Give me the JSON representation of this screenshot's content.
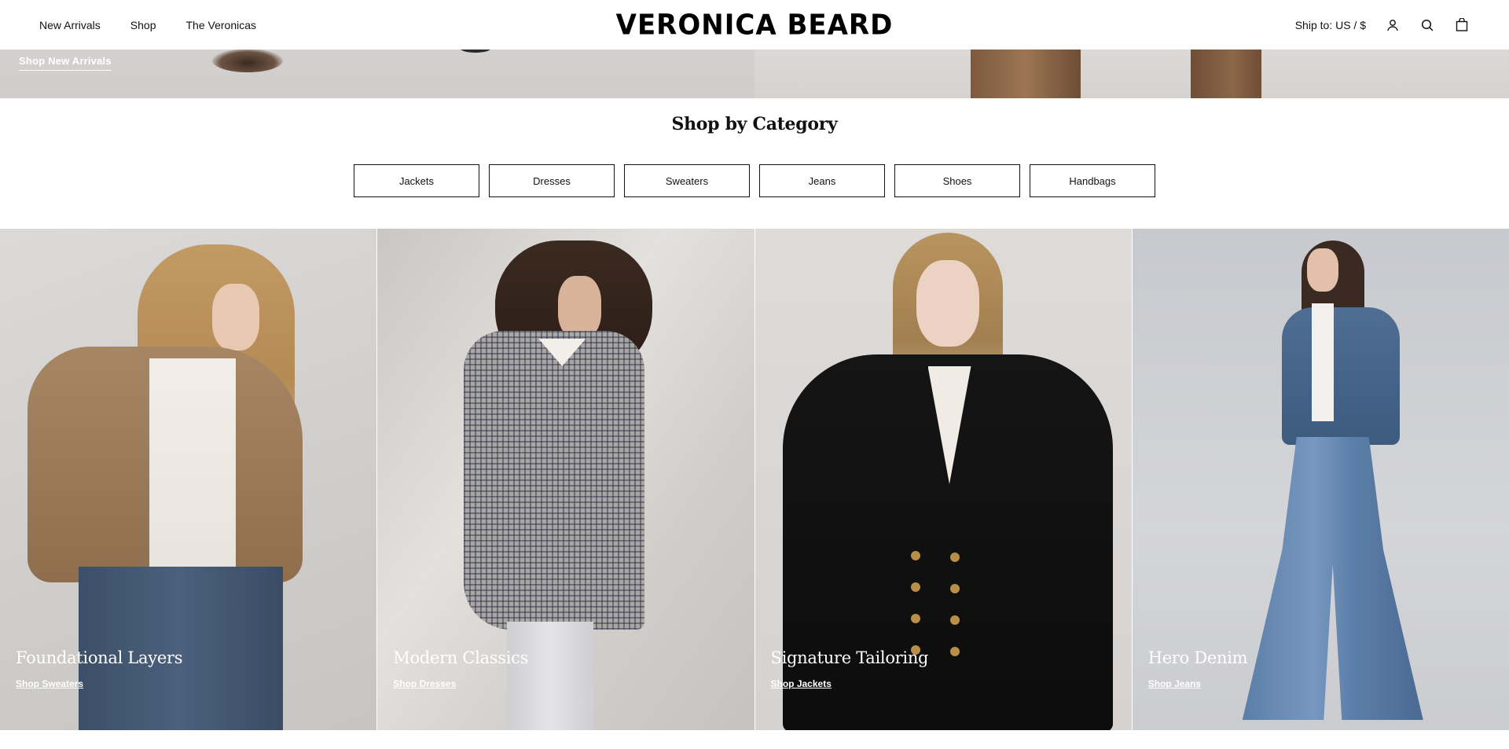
{
  "header": {
    "nav": [
      "New Arrivals",
      "Shop",
      "The Veronicas"
    ],
    "logo": "VERONICA BEARD",
    "ship_to": "Ship to: US / $",
    "icons": [
      "account-icon",
      "search-icon",
      "bag-icon"
    ]
  },
  "hero": {
    "link": "Shop New Arrivals"
  },
  "categories": {
    "title": "Shop by Category",
    "buttons": [
      "Jackets",
      "Dresses",
      "Sweaters",
      "Jeans",
      "Shoes",
      "Handbags"
    ]
  },
  "tiles": [
    {
      "title": "Foundational Layers",
      "link": "Shop Sweaters"
    },
    {
      "title": "Modern Classics",
      "link": "Shop Dresses"
    },
    {
      "title": "Signature Tailoring",
      "link": "Shop Jackets"
    },
    {
      "title": "Hero Denim",
      "link": "Shop Jeans"
    }
  ],
  "colors": {
    "text": "#111111",
    "background": "#ffffff",
    "overlay_text": "#ffffff"
  }
}
